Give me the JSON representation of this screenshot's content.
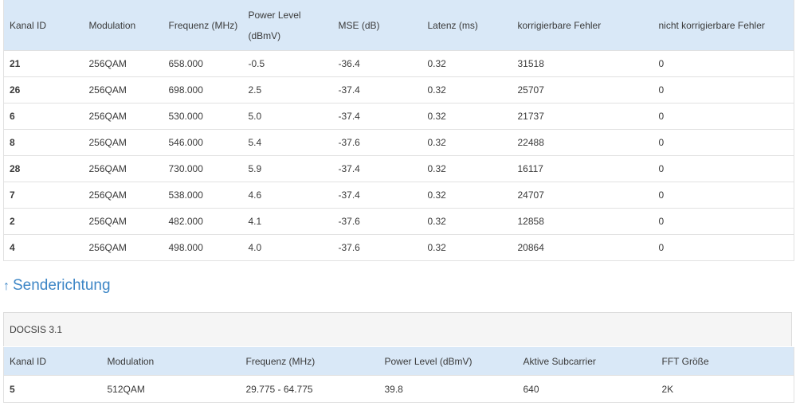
{
  "downstream": {
    "headers": [
      "Kanal ID",
      "Modulation",
      "Frequenz (MHz)",
      "Power Level (dBmV)",
      "MSE (dB)",
      "Latenz (ms)",
      "korrigierbare Fehler",
      "nicht korrigierbare Fehler"
    ],
    "rows": [
      [
        "21",
        "256QAM",
        "658.000",
        "-0.5",
        "-36.4",
        "0.32",
        "31518",
        "0"
      ],
      [
        "26",
        "256QAM",
        "698.000",
        "2.5",
        "-37.4",
        "0.32",
        "25707",
        "0"
      ],
      [
        "6",
        "256QAM",
        "530.000",
        "5.0",
        "-37.4",
        "0.32",
        "21737",
        "0"
      ],
      [
        "8",
        "256QAM",
        "546.000",
        "5.4",
        "-37.6",
        "0.32",
        "22488",
        "0"
      ],
      [
        "28",
        "256QAM",
        "730.000",
        "5.9",
        "-37.4",
        "0.32",
        "16117",
        "0"
      ],
      [
        "7",
        "256QAM",
        "538.000",
        "4.6",
        "-37.4",
        "0.32",
        "24707",
        "0"
      ],
      [
        "2",
        "256QAM",
        "482.000",
        "4.1",
        "-37.6",
        "0.32",
        "12858",
        "0"
      ],
      [
        "4",
        "256QAM",
        "498.000",
        "4.0",
        "-37.6",
        "0.32",
        "20864",
        "0"
      ]
    ]
  },
  "upstream": {
    "section_title": "Senderichtung",
    "panel_heading": "DOCSIS 3.1",
    "headers": [
      "Kanal ID",
      "Modulation",
      "Frequenz (MHz)",
      "Power Level (dBmV)",
      "Aktive Subcarrier",
      "FFT Größe"
    ],
    "rows": [
      [
        "5",
        "512QAM",
        "29.775 - 64.775",
        "39.8",
        "640",
        "2K"
      ]
    ]
  },
  "icons": {
    "section_arrow": "arrow-up-icon"
  },
  "colors": {
    "header_bg": "#d9e8f7",
    "link": "#3d86c6",
    "panel_bg": "#f5f5f5"
  }
}
